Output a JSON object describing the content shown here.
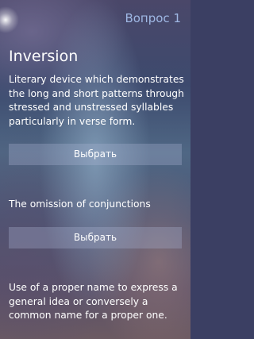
{
  "header": {
    "title": "Вопрос 1"
  },
  "question": {
    "term": "Inversion"
  },
  "options": [
    {
      "text": "Literary device which demonstrates the long and short patterns through stressed and unstressed syllables particularly in verse form.",
      "button_label": "Выбрать"
    },
    {
      "text": "The omission of conjunctions",
      "button_label": "Выбрать"
    },
    {
      "text": "Use of a proper name to express a general idea or conversely a common name for a proper one.",
      "button_label": "Выбрать"
    }
  ],
  "colors": {
    "header_accent": "#9fb8e4",
    "text": "#ffffff"
  }
}
